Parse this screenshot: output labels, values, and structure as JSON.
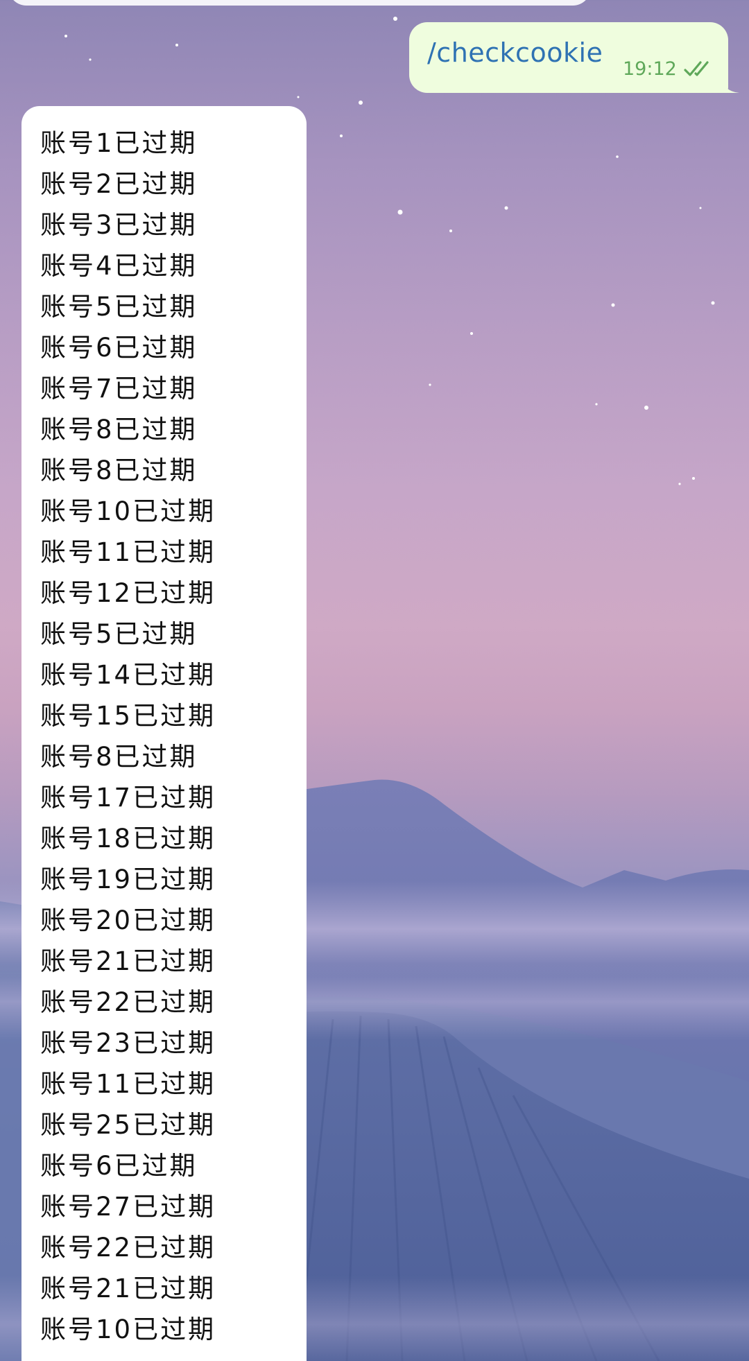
{
  "outgoing_message": {
    "text": "/checkcookie",
    "time": "19:12",
    "status_icon": "double-check-icon",
    "bubble_color": "#effdde",
    "text_color": "#2f72b3",
    "time_color": "#5fa85a"
  },
  "incoming_message": {
    "bubble_color": "#ffffff",
    "lines": [
      "账号1已过期",
      "账号2已过期",
      "账号3已过期",
      "账号4已过期",
      "账号5已过期",
      "账号6已过期",
      "账号7已过期",
      "账号8已过期",
      "账号8已过期",
      "账号10已过期",
      "账号11已过期",
      "账号12已过期",
      "账号5已过期",
      "账号14已过期",
      "账号15已过期",
      "账号8已过期",
      "账号17已过期",
      "账号18已过期",
      "账号19已过期",
      "账号20已过期",
      "账号21已过期",
      "账号22已过期",
      "账号23已过期",
      "账号11已过期",
      "账号25已过期",
      "账号6已过期",
      "账号27已过期",
      "账号22已过期",
      "账号21已过期",
      "账号10已过期"
    ]
  }
}
